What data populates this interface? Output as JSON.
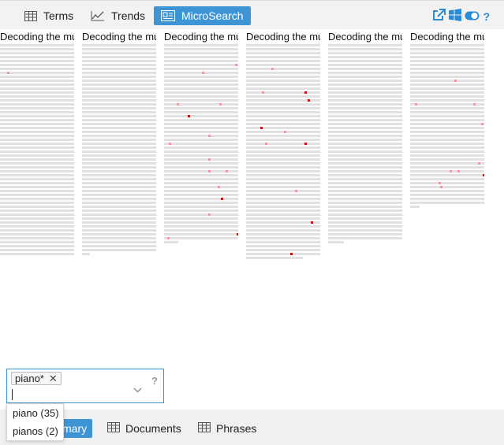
{
  "toolbar": {
    "tabs": [
      {
        "label": "Terms",
        "icon": "table-icon"
      },
      {
        "label": "Trends",
        "icon": "line-chart-icon"
      },
      {
        "label": "MicroSearch",
        "icon": "microsearch-icon",
        "active": true
      }
    ],
    "tools": [
      "export-icon",
      "windows-icon",
      "toggle-icon",
      "help-icon"
    ]
  },
  "documents": [
    {
      "title": "Decoding the music"
    },
    {
      "title": "Decoding the music"
    },
    {
      "title": "Decoding the music"
    },
    {
      "title": "Decoding the music"
    },
    {
      "title": "Decoding the music"
    },
    {
      "title": "Decoding the music"
    }
  ],
  "search": {
    "term": "piano*",
    "remove_icon": "close-icon",
    "help": "?"
  },
  "suggestions": [
    {
      "label": "piano (35)"
    },
    {
      "label": "pianos (2)"
    }
  ],
  "bottom_tabs": [
    {
      "label": "Summary",
      "visible_label": "mary",
      "icon": "summary-icon",
      "active": true
    },
    {
      "label": "Documents",
      "icon": "table-icon"
    },
    {
      "label": "Phrases",
      "icon": "table-icon"
    }
  ],
  "colors": {
    "accent": "#3e95d5",
    "match_strong": "#cc1111",
    "match_weak": "#ec9aa2"
  }
}
